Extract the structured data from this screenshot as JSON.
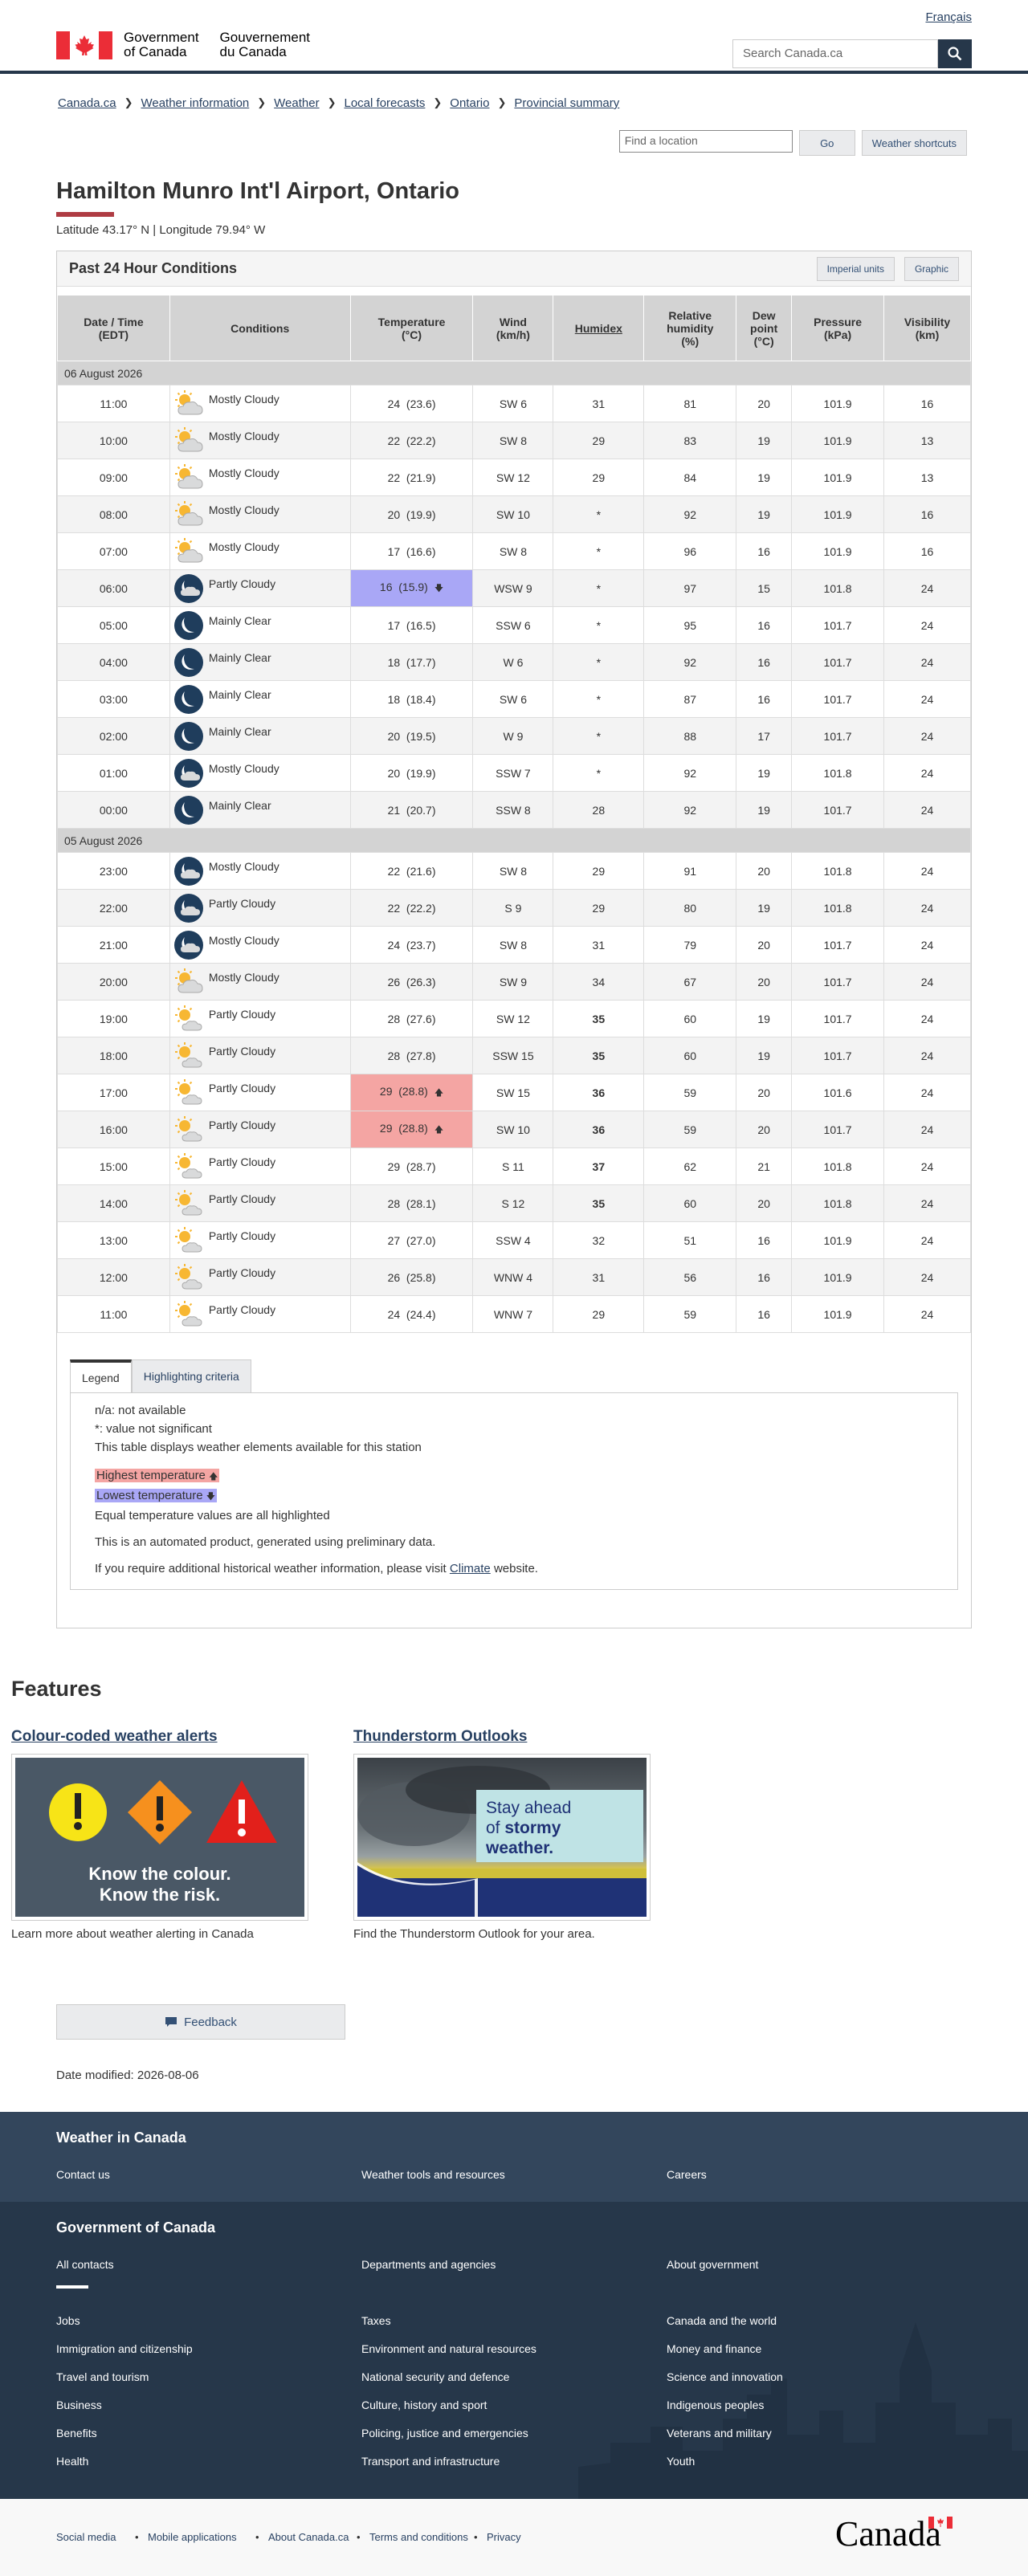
{
  "header": {
    "lang_link": "Français",
    "gov_en": [
      "Government",
      "of Canada"
    ],
    "gov_fr": [
      "Gouvernement",
      "du Canada"
    ],
    "search_placeholder": "Search Canada.ca"
  },
  "breadcrumb": [
    "Canada.ca",
    "Weather information",
    "Weather",
    "Local forecasts",
    "Ontario",
    "Provincial summary"
  ],
  "location_search": {
    "placeholder": "Find a location",
    "go": "Go",
    "shortcuts": "Weather shortcuts"
  },
  "page": {
    "title": "Hamilton Munro Int'l Airport, Ontario",
    "latlon": "Latitude 43.17° N | Longitude 79.94° W"
  },
  "panel": {
    "title": "Past 24 Hour Conditions",
    "imperial_btn": "Imperial units",
    "graphic_btn": "Graphic"
  },
  "table": {
    "headers": [
      "Date / Time\n(EDT)",
      "Conditions",
      "Temperature\n(°C)",
      "Wind\n(km/h)",
      "Humidex",
      "Relative\nhumidity\n(%)",
      "Dew\npoint\n(°C)",
      "Pressure\n(kPa)",
      "Visibility\n(km)"
    ],
    "groups": [
      {
        "date": "06 August 2026",
        "rows": [
          {
            "time": "11:00",
            "icon": "day-cloudy",
            "cond": "Mostly Cloudy",
            "temp": "24  (23.6)",
            "wind": "SW 6",
            "hx": "31",
            "rh": "81",
            "dp": "20",
            "p": "101.9",
            "v": "16"
          },
          {
            "time": "10:00",
            "icon": "day-cloudy",
            "cond": "Mostly Cloudy",
            "temp": "22  (22.2)",
            "wind": "SW 8",
            "hx": "29",
            "rh": "83",
            "dp": "19",
            "p": "101.9",
            "v": "13"
          },
          {
            "time": "09:00",
            "icon": "day-cloudy",
            "cond": "Mostly Cloudy",
            "temp": "22  (21.9)",
            "wind": "SW 12",
            "hx": "29",
            "rh": "84",
            "dp": "19",
            "p": "101.9",
            "v": "13"
          },
          {
            "time": "08:00",
            "icon": "day-cloudy",
            "cond": "Mostly Cloudy",
            "temp": "20  (19.9)",
            "wind": "SW 10",
            "hx": "*",
            "rh": "92",
            "dp": "19",
            "p": "101.9",
            "v": "16"
          },
          {
            "time": "07:00",
            "icon": "day-cloudy",
            "cond": "Mostly Cloudy",
            "temp": "17  (16.6)",
            "wind": "SW 8",
            "hx": "*",
            "rh": "96",
            "dp": "16",
            "p": "101.9",
            "v": "16"
          },
          {
            "time": "06:00",
            "icon": "night-cloudy",
            "cond": "Partly Cloudy",
            "temp": "16  (15.9)",
            "wind": "WSW 9",
            "hx": "*",
            "rh": "97",
            "dp": "15",
            "p": "101.8",
            "v": "24",
            "mark": "lo"
          },
          {
            "time": "05:00",
            "icon": "night-clear",
            "cond": "Mainly Clear",
            "temp": "17  (16.5)",
            "wind": "SSW 6",
            "hx": "*",
            "rh": "95",
            "dp": "16",
            "p": "101.7",
            "v": "24"
          },
          {
            "time": "04:00",
            "icon": "night-clear",
            "cond": "Mainly Clear",
            "temp": "18  (17.7)",
            "wind": "W 6",
            "hx": "*",
            "rh": "92",
            "dp": "16",
            "p": "101.7",
            "v": "24"
          },
          {
            "time": "03:00",
            "icon": "night-clear",
            "cond": "Mainly Clear",
            "temp": "18  (18.4)",
            "wind": "SW 6",
            "hx": "*",
            "rh": "87",
            "dp": "16",
            "p": "101.7",
            "v": "24"
          },
          {
            "time": "02:00",
            "icon": "night-clear",
            "cond": "Mainly Clear",
            "temp": "20  (19.5)",
            "wind": "W 9",
            "hx": "*",
            "rh": "88",
            "dp": "17",
            "p": "101.7",
            "v": "24"
          },
          {
            "time": "01:00",
            "icon": "night-cloudy",
            "cond": "Mostly Cloudy",
            "temp": "20  (19.9)",
            "wind": "SSW 7",
            "hx": "*",
            "rh": "92",
            "dp": "19",
            "p": "101.8",
            "v": "24"
          },
          {
            "time": "00:00",
            "icon": "night-clear",
            "cond": "Mainly Clear",
            "temp": "21  (20.7)",
            "wind": "SSW 8",
            "hx": "28",
            "rh": "92",
            "dp": "19",
            "p": "101.7",
            "v": "24"
          }
        ]
      },
      {
        "date": "05 August 2026",
        "rows": [
          {
            "time": "23:00",
            "icon": "night-cloudy",
            "cond": "Mostly Cloudy",
            "temp": "22  (21.6)",
            "wind": "SW 8",
            "hx": "29",
            "rh": "91",
            "dp": "20",
            "p": "101.8",
            "v": "24"
          },
          {
            "time": "22:00",
            "icon": "night-cloudy",
            "cond": "Partly Cloudy",
            "temp": "22  (22.2)",
            "wind": "S 9",
            "hx": "29",
            "rh": "80",
            "dp": "19",
            "p": "101.8",
            "v": "24"
          },
          {
            "time": "21:00",
            "icon": "night-cloudy",
            "cond": "Mostly Cloudy",
            "temp": "24  (23.7)",
            "wind": "SW 8",
            "hx": "31",
            "rh": "79",
            "dp": "20",
            "p": "101.7",
            "v": "24"
          },
          {
            "time": "20:00",
            "icon": "day-cloudy",
            "cond": "Mostly Cloudy",
            "temp": "26  (26.3)",
            "wind": "SW 9",
            "hx": "34",
            "rh": "67",
            "dp": "20",
            "p": "101.7",
            "v": "24"
          },
          {
            "time": "19:00",
            "icon": "day-sun",
            "cond": "Partly Cloudy",
            "temp": "28  (27.6)",
            "wind": "SW 12",
            "hx": "35",
            "hxb": true,
            "rh": "60",
            "dp": "19",
            "p": "101.7",
            "v": "24"
          },
          {
            "time": "18:00",
            "icon": "day-sun",
            "cond": "Partly Cloudy",
            "temp": "28  (27.8)",
            "wind": "SSW 15",
            "hx": "35",
            "hxb": true,
            "rh": "60",
            "dp": "19",
            "p": "101.7",
            "v": "24"
          },
          {
            "time": "17:00",
            "icon": "day-sun",
            "cond": "Partly Cloudy",
            "temp": "29  (28.8)",
            "wind": "SW 15",
            "hx": "36",
            "hxb": true,
            "rh": "59",
            "dp": "20",
            "p": "101.6",
            "v": "24",
            "mark": "hi"
          },
          {
            "time": "16:00",
            "icon": "day-sun",
            "cond": "Partly Cloudy",
            "temp": "29  (28.8)",
            "wind": "SW 10",
            "hx": "36",
            "hxb": true,
            "rh": "59",
            "dp": "20",
            "p": "101.7",
            "v": "24",
            "mark": "hi"
          },
          {
            "time": "15:00",
            "icon": "day-sun",
            "cond": "Partly Cloudy",
            "temp": "29  (28.7)",
            "wind": "S 11",
            "hx": "37",
            "hxb": true,
            "rh": "62",
            "dp": "21",
            "p": "101.8",
            "v": "24"
          },
          {
            "time": "14:00",
            "icon": "day-sun",
            "cond": "Partly Cloudy",
            "temp": "28  (28.1)",
            "wind": "S 12",
            "hx": "35",
            "hxb": true,
            "rh": "60",
            "dp": "20",
            "p": "101.8",
            "v": "24"
          },
          {
            "time": "13:00",
            "icon": "day-sun",
            "cond": "Partly Cloudy",
            "temp": "27  (27.0)",
            "wind": "SSW 4",
            "hx": "32",
            "rh": "51",
            "dp": "16",
            "p": "101.9",
            "v": "24"
          },
          {
            "time": "12:00",
            "icon": "day-sun",
            "cond": "Partly Cloudy",
            "temp": "26  (25.8)",
            "wind": "WNW 4",
            "hx": "31",
            "rh": "56",
            "dp": "16",
            "p": "101.9",
            "v": "24"
          },
          {
            "time": "11:00",
            "icon": "day-sun",
            "cond": "Partly Cloudy",
            "temp": "24  (24.4)",
            "wind": "WNW 7",
            "hx": "29",
            "rh": "59",
            "dp": "16",
            "p": "101.9",
            "v": "24"
          }
        ]
      }
    ]
  },
  "legend": {
    "tab_legend": "Legend",
    "tab_criteria": "Highlighting criteria",
    "na": "n/a: not available",
    "star": "*: value not significant",
    "elements": "This table displays weather elements available for this station",
    "highest": "Highest temperature",
    "lowest": "Lowest temperature",
    "equal": "Equal temperature values are all highlighted",
    "automated": "This is an automated product, generated using preliminary data.",
    "climate_pre": "If you require additional historical weather information, please visit",
    "climate_link": "Climate",
    "climate_post": "website."
  },
  "features": {
    "heading": "Features",
    "item1_title": "Colour-coded weather alerts",
    "item1_img_line1": "Know the colour.",
    "item1_img_line2": "Know the risk.",
    "item1_caption": "Learn more about weather alerting in Canada",
    "item2_title": "Thunderstorm Outlooks",
    "item2_img_line1": "Stay ahead",
    "item2_img_line2a": "of ",
    "item2_img_line2b": "stormy",
    "item2_img_line3": "weather.",
    "item2_caption": "Find the Thunderstorm Outlook for your area."
  },
  "feedback": "Feedback",
  "date_modified": "Date modified: 2026-08-06",
  "footer": {
    "weather_heading": "Weather in Canada",
    "weather_links": [
      "Contact us",
      "Weather tools and resources",
      "Careers"
    ],
    "gov_heading": "Government of Canada",
    "gov_top": [
      "All contacts",
      "Departments and agencies",
      "About government"
    ],
    "gov_links": [
      [
        "Jobs",
        "Taxes",
        "Canada and the world"
      ],
      [
        "Immigration and citizenship",
        "Environment and natural resources",
        "Money and finance"
      ],
      [
        "Travel and tourism",
        "National security and defence",
        "Science and innovation"
      ],
      [
        "Business",
        "Culture, history and sport",
        "Indigenous peoples"
      ],
      [
        "Benefits",
        "Policing, justice and emergencies",
        "Veterans and military"
      ],
      [
        "Health",
        "Transport and infrastructure",
        "Youth"
      ]
    ],
    "bottom_links": [
      "Social media",
      "Mobile applications",
      "About Canada.ca",
      "Terms and conditions",
      "Privacy"
    ],
    "wordmark": "Canada"
  },
  "colors": {
    "navy": "#26374a",
    "hi": "#f4a5a3",
    "lo": "#a9a7f6",
    "accent_red": "#af3c43"
  }
}
